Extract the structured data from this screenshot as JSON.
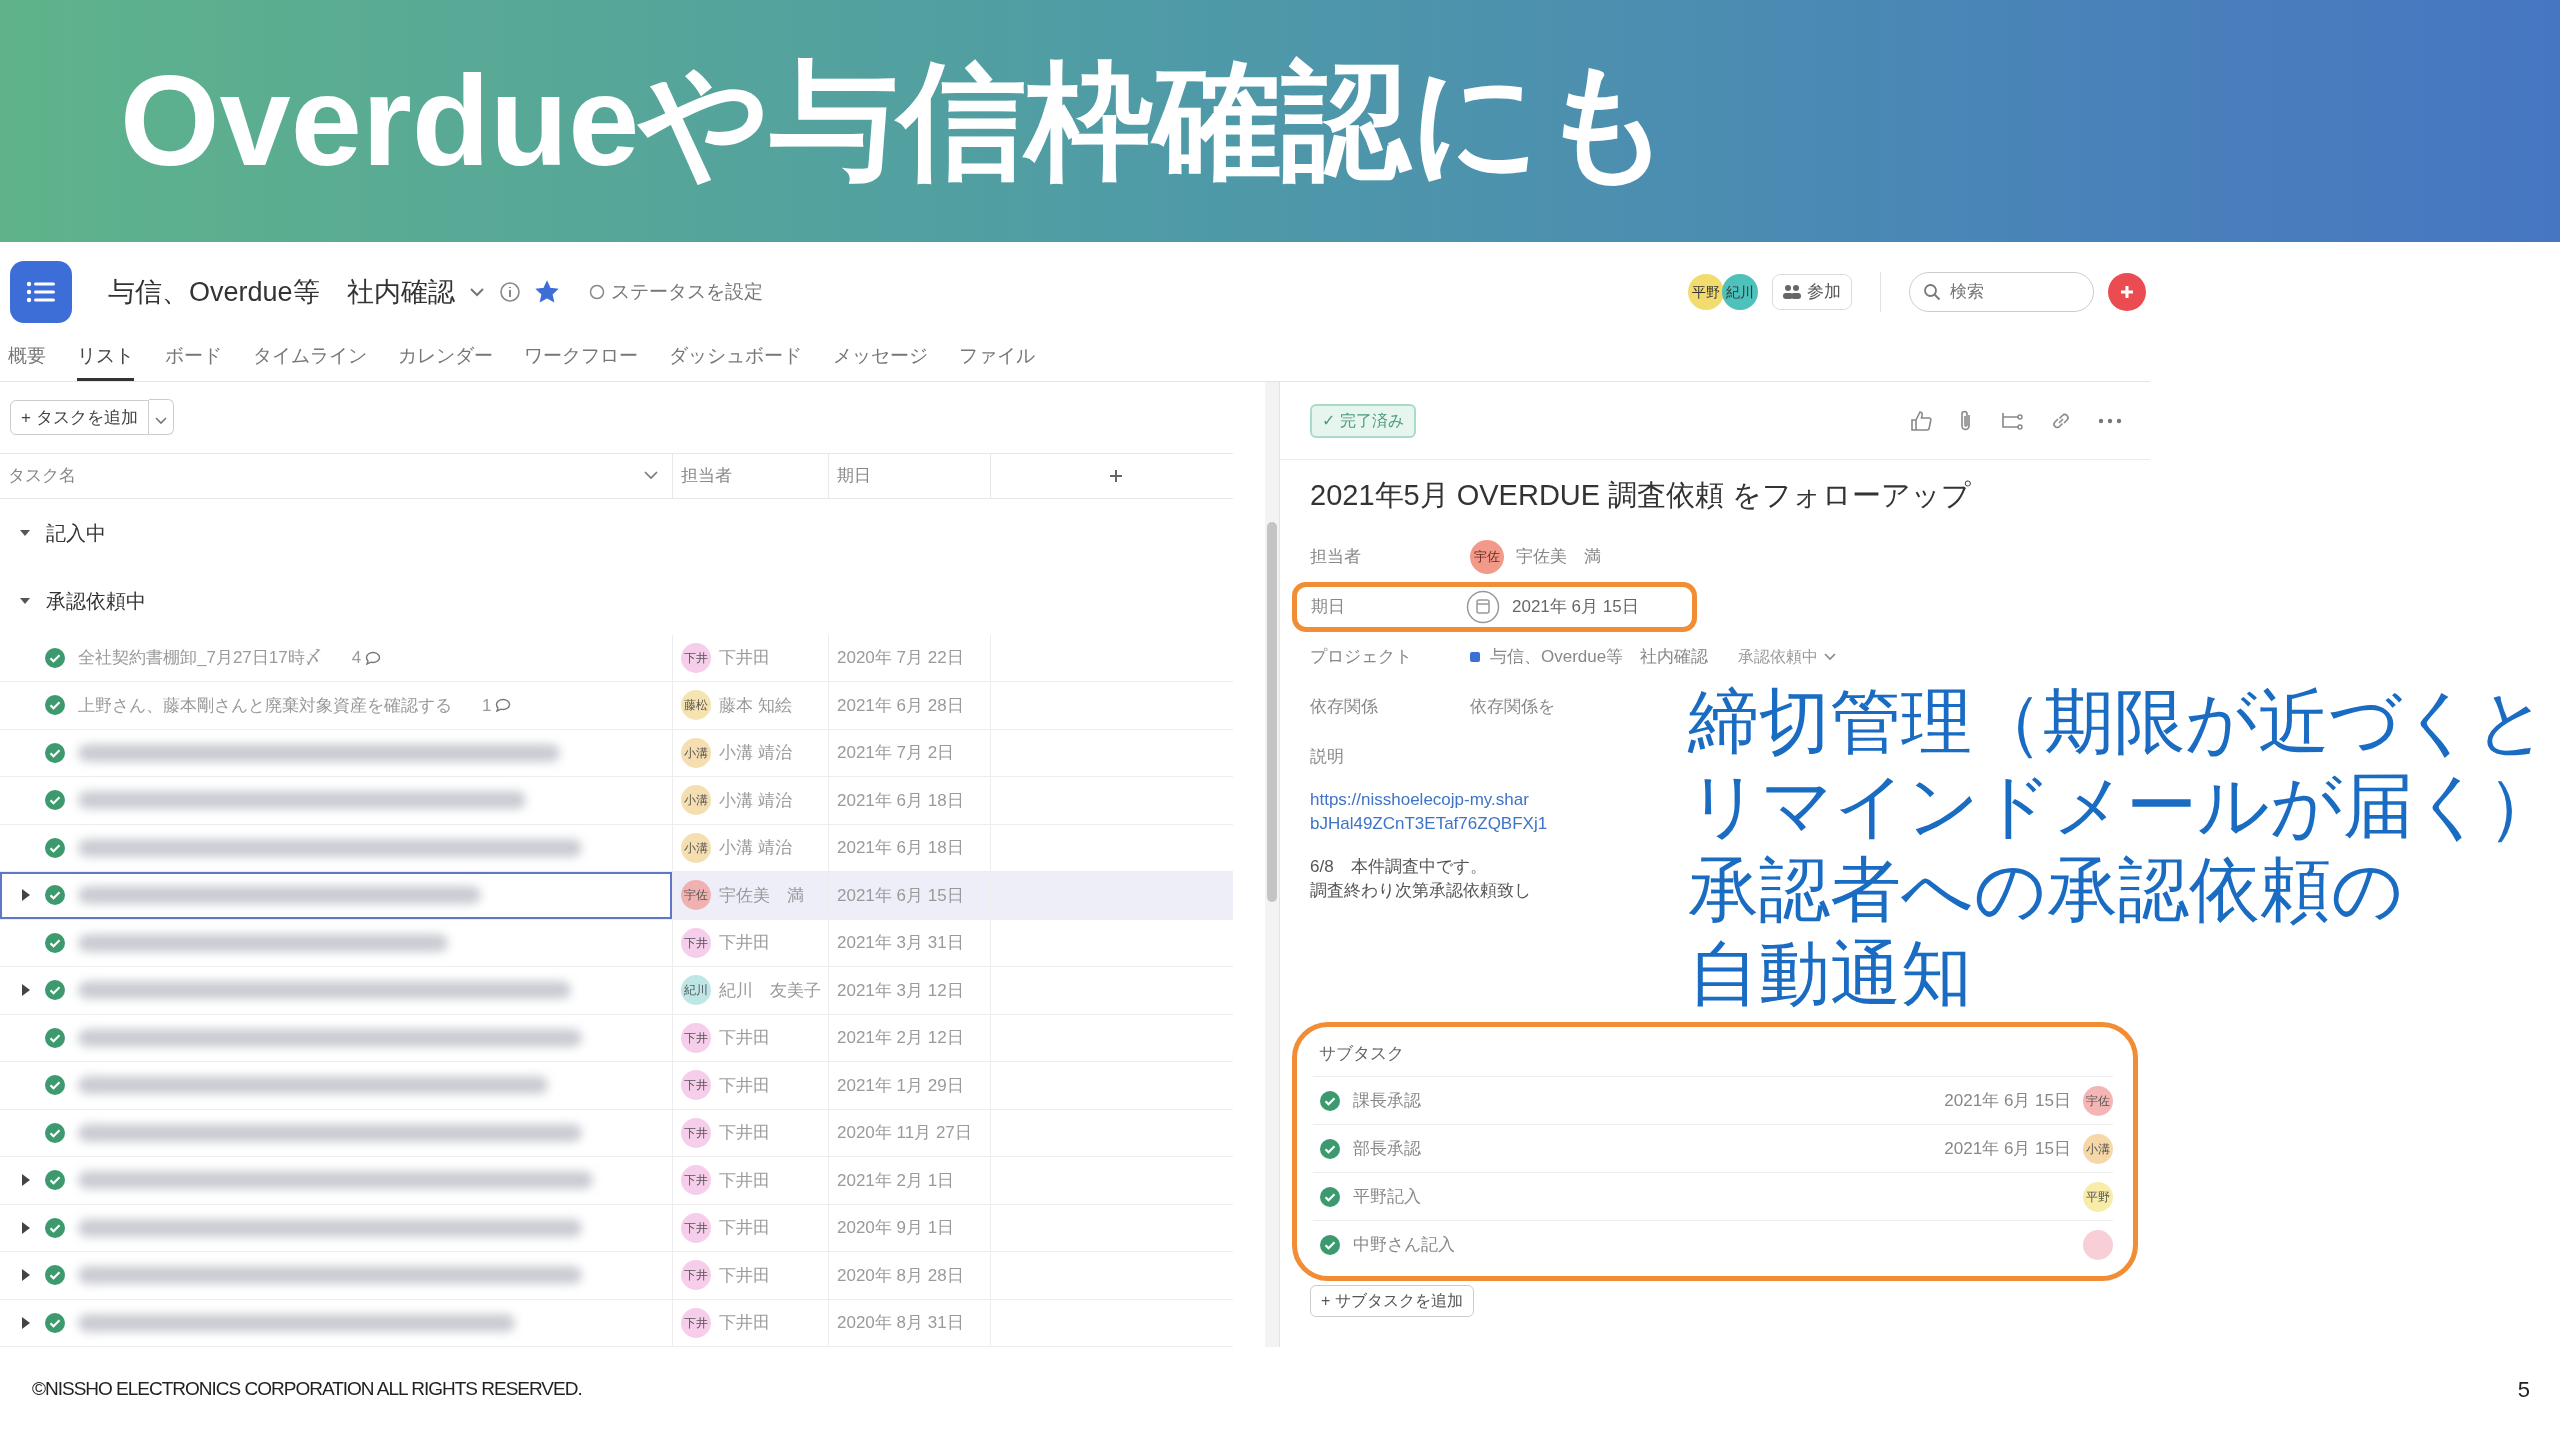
{
  "slide": {
    "title": "Overdueや与信枠確認にも",
    "callout_lines": [
      "締切管理（期限が近づくと",
      "リマインドメールが届く）",
      "承認者への承認依頼の",
      "自動通知"
    ],
    "footer": "©NISSHO ELECTRONICS CORPORATION ALL RIGHTS RESERVED.",
    "page_number": "5"
  },
  "app": {
    "project_title": "与信、Overdue等　社内確認",
    "starred": true,
    "status_button": "ステータスを設定",
    "members": [
      {
        "initials": "平野",
        "color": "#f3dc6e"
      },
      {
        "initials": "紀川",
        "color": "#4fc1bb"
      }
    ],
    "join_button": "参加",
    "search": {
      "placeholder": "検索"
    },
    "tabs": [
      {
        "label": "概要",
        "selected": false
      },
      {
        "label": "リスト",
        "selected": true
      },
      {
        "label": "ボード",
        "selected": false
      },
      {
        "label": "タイムライン",
        "selected": false
      },
      {
        "label": "カレンダー",
        "selected": false
      },
      {
        "label": "ワークフロー",
        "selected": false
      },
      {
        "label": "ダッシュボード",
        "selected": false
      },
      {
        "label": "メッセージ",
        "selected": false
      },
      {
        "label": "ファイル",
        "selected": false
      }
    ],
    "add_task_button": "+ タスクを追加",
    "columns": [
      "タスク名",
      "担当者",
      "期日"
    ],
    "sections": [
      {
        "name": "記入中",
        "expanded": true
      },
      {
        "name": "承認依頼中",
        "expanded": true,
        "tasks": [
          {
            "kind": "named",
            "name": "全社契約書棚卸_7月27日17時〆",
            "comments": "4",
            "has_subtasks": false,
            "completed": true,
            "selected": false,
            "avatar": "下井",
            "color": "#f6cdea",
            "assignee": "下井田",
            "due": "2020年 7月 22日"
          },
          {
            "kind": "named",
            "name": "上野さん、藤本剛さんと廃棄対象資産を確認する",
            "comments": "1",
            "has_subtasks": false,
            "completed": true,
            "selected": false,
            "avatar": "藤松",
            "color": "#f5e3b0",
            "assignee": "藤本 知絵",
            "due": "2021年 6月 28日"
          },
          {
            "kind": "blurred",
            "has_subtasks": false,
            "completed": true,
            "selected": false,
            "avatar": "小溝",
            "color": "#f5deb0",
            "assignee": "小溝 靖治",
            "due": "2021年 7月 2日"
          },
          {
            "kind": "blurred",
            "has_subtasks": false,
            "completed": true,
            "selected": false,
            "avatar": "小溝",
            "color": "#f5deb0",
            "assignee": "小溝 靖治",
            "due": "2021年 6月 18日"
          },
          {
            "kind": "blurred",
            "has_subtasks": false,
            "completed": true,
            "selected": false,
            "avatar": "小溝",
            "color": "#f5deb0",
            "assignee": "小溝 靖治",
            "due": "2021年 6月 18日"
          },
          {
            "kind": "blurred",
            "has_subtasks": true,
            "completed": true,
            "selected": true,
            "avatar": "宇佐",
            "color": "#f2b1b1",
            "assignee": "宇佐美　満",
            "due": "2021年 6月 15日"
          },
          {
            "kind": "blurred",
            "has_subtasks": false,
            "completed": true,
            "selected": false,
            "avatar": "下井",
            "color": "#f6cdea",
            "assignee": "下井田",
            "due": "2021年 3月 31日"
          },
          {
            "kind": "blurred",
            "has_subtasks": true,
            "completed": true,
            "selected": false,
            "avatar": "紀川",
            "color": "#bfe6e6",
            "assignee": "紀川　友美子",
            "due": "2021年 3月 12日"
          },
          {
            "kind": "blurred",
            "has_subtasks": false,
            "completed": true,
            "selected": false,
            "avatar": "下井",
            "color": "#f6cdea",
            "assignee": "下井田",
            "due": "2021年 2月 12日"
          },
          {
            "kind": "blurred",
            "has_subtasks": false,
            "completed": true,
            "selected": false,
            "avatar": "下井",
            "color": "#f6cdea",
            "assignee": "下井田",
            "due": "2021年 1月 29日"
          },
          {
            "kind": "blurred",
            "has_subtasks": false,
            "completed": true,
            "selected": false,
            "avatar": "下井",
            "color": "#f6cdea",
            "assignee": "下井田",
            "due": "2020年 11月 27日"
          },
          {
            "kind": "blurred",
            "has_subtasks": true,
            "completed": true,
            "selected": false,
            "avatar": "下井",
            "color": "#f6cdea",
            "assignee": "下井田",
            "due": "2021年 2月 1日"
          },
          {
            "kind": "blurred",
            "has_subtasks": true,
            "completed": true,
            "selected": false,
            "avatar": "下井",
            "color": "#f6cdea",
            "assignee": "下井田",
            "due": "2020年 9月 1日"
          },
          {
            "kind": "blurred",
            "has_subtasks": true,
            "completed": true,
            "selected": false,
            "avatar": "下井",
            "color": "#f6cdea",
            "assignee": "下井田",
            "due": "2020年 8月 28日"
          },
          {
            "kind": "blurred",
            "has_subtasks": true,
            "completed": true,
            "selected": false,
            "avatar": "下井",
            "color": "#f6cdea",
            "assignee": "下井田",
            "due": "2020年 8月 31日"
          }
        ]
      }
    ],
    "detail": {
      "completed_button": "✓ 完了済み",
      "title": "2021年5月 OVERDUE 調査依頼 をフォローアップ",
      "assignee_label": "担当者",
      "assignee_avatar": "宇佐",
      "assignee": "宇佐美　満",
      "due_label": "期日",
      "due": "2021年 6月 15日",
      "project_label": "プロジェクト",
      "project": "与信、Overdue等　社内確認",
      "project_section": "承認依頼中",
      "dependency_label": "依存関係",
      "dependency": "依存関係を",
      "description_label": "説明",
      "description_link": [
        "https://nisshoelecojp-my.shar",
        "bJHal49ZCnT3ETaf76ZQBFXj1"
      ],
      "description_text": [
        "6/8　本件調査中です。",
        "調査終わり次第承認依頼致し"
      ],
      "subtasks_label": "サブタスク",
      "subtasks": [
        {
          "name": "課長承認",
          "completed": true,
          "due": "2021年 6月 15日",
          "avatar": "宇佐",
          "color": "#f5b5b5"
        },
        {
          "name": "部長承認",
          "completed": true,
          "due": "2021年 6月 15日",
          "avatar": "小溝",
          "color": "#f5d7a8"
        },
        {
          "name": "平野記入",
          "completed": true,
          "avatar": "平野",
          "color": "#f8eca8"
        },
        {
          "name": "中野さん記入",
          "completed": true,
          "color": "#f8cfd6"
        }
      ],
      "add_subtask_button": "+ サブタスクを追加"
    }
  }
}
